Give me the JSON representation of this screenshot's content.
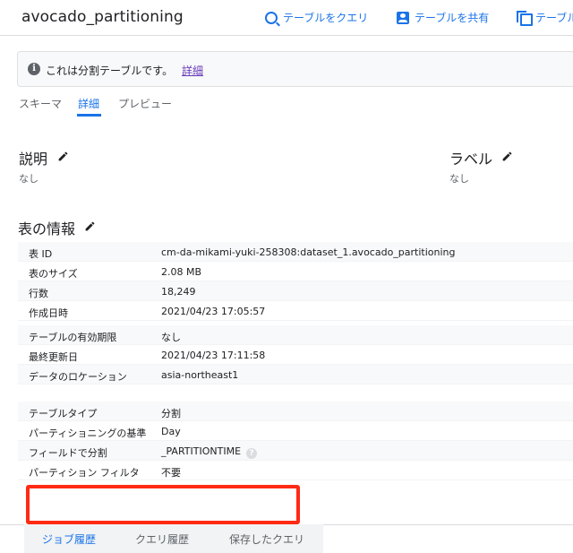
{
  "header": {
    "title": "avocado_partitioning",
    "actions": [
      {
        "label": "テーブルをクエリ",
        "icon": "query-icon"
      },
      {
        "label": "テーブルを共有",
        "icon": "share-icon"
      },
      {
        "label": "テーブル",
        "icon": "copy-icon"
      }
    ]
  },
  "banner": {
    "message": "これは分割テーブルです。",
    "link": "詳細",
    "icon": "info-icon"
  },
  "tabs": [
    {
      "label": "スキーマ"
    },
    {
      "label": "詳細",
      "active": true
    },
    {
      "label": "プレビュー"
    }
  ],
  "description": {
    "title": "説明",
    "value": "なし"
  },
  "labels": {
    "title": "ラベル",
    "value": "なし"
  },
  "table_info": {
    "title": "表の情報",
    "rows": [
      {
        "key": "表 ID",
        "value": "cm-da-mikami-yuki-258308:dataset_1.avocado_partitioning"
      },
      {
        "key": "表のサイズ",
        "value": "2.08 MB"
      },
      {
        "key": "行数",
        "value": "18,249"
      },
      {
        "key": "作成日時",
        "value": "2021/04/23 17:05:57"
      },
      {
        "key": "テーブルの有効期限",
        "value": "なし"
      },
      {
        "key": "最終更新日",
        "value": "2021/04/23 17:11:58"
      },
      {
        "key": "データのロケーション",
        "value": "asia-northeast1"
      }
    ],
    "partition_rows": [
      {
        "key": "テーブルタイプ",
        "value": "分割"
      },
      {
        "key": "パーティショニングの基準",
        "value": "Day"
      },
      {
        "key": "フィールドで分割",
        "value": "_PARTITIONTIME"
      },
      {
        "key": "パーティション フィルタ",
        "value": "不要"
      }
    ]
  },
  "bottom_tabs": [
    {
      "label": "ジョブ履歴",
      "active": true
    },
    {
      "label": "クエリ履歴"
    },
    {
      "label": "保存したクエリ"
    }
  ],
  "colors": {
    "accent": "#1a73e8",
    "highlight": "#ff2a14",
    "link": "#673ab7"
  }
}
